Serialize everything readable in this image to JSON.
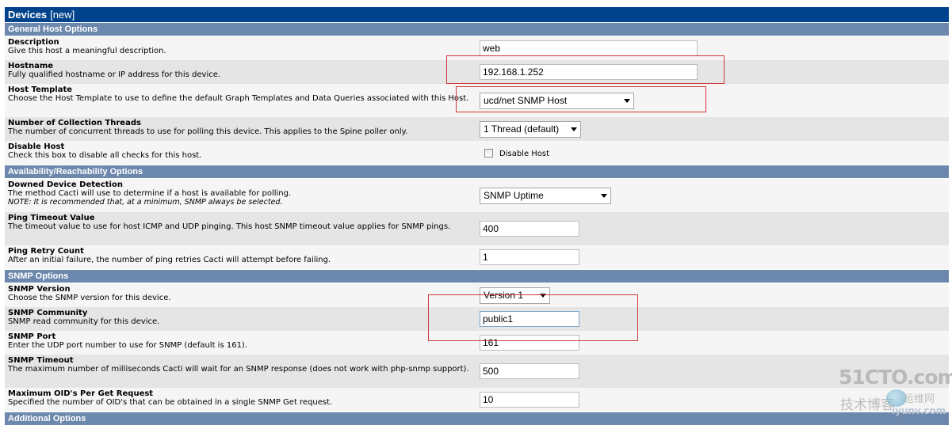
{
  "header": {
    "title": "Devices",
    "subtitle": "[new]"
  },
  "sections": {
    "general": "General Host Options",
    "availability": "Availability/Reachability Options",
    "snmp": "SNMP Options",
    "additional": "Additional Options"
  },
  "fields": {
    "description": {
      "label": "Description",
      "help": "Give this host a meaningful description.",
      "value": "web"
    },
    "hostname": {
      "label": "Hostname",
      "help": "Fully qualified hostname or IP address for this device.",
      "value": "192.168.1.252"
    },
    "host_template": {
      "label": "Host Template",
      "help": "Choose the Host Template to use to define the default Graph Templates and Data Queries associated with this Host.",
      "value": "ucd/net SNMP Host"
    },
    "threads": {
      "label": "Number of Collection Threads",
      "help": "The number of concurrent threads to use for polling this device. This applies to the Spine poller only.",
      "value": "1 Thread (default)"
    },
    "disable_host": {
      "label": "Disable Host",
      "help": "Check this box to disable all checks for this host.",
      "checkbox_label": "Disable Host",
      "checked": false
    },
    "downed_detection": {
      "label": "Downed Device Detection",
      "help": "The method Cacti will use to determine if a host is available for polling.",
      "note": "NOTE: It is recommended that, at a minimum, SNMP always be selected.",
      "value": "SNMP Uptime"
    },
    "ping_timeout": {
      "label": "Ping Timeout Value",
      "help": "The timeout value to use for host ICMP and UDP pinging. This host SNMP timeout value applies for SNMP pings.",
      "value": "400"
    },
    "ping_retry": {
      "label": "Ping Retry Count",
      "help": "After an initial failure, the number of ping retries Cacti will attempt before failing.",
      "value": "1"
    },
    "snmp_version": {
      "label": "SNMP Version",
      "help": "Choose the SNMP version for this device.",
      "value": "Version 1"
    },
    "snmp_community": {
      "label": "SNMP Community",
      "help": "SNMP read community for this device.",
      "value": "public1"
    },
    "snmp_port": {
      "label": "SNMP Port",
      "help": "Enter the UDP port number to use for SNMP (default is 161).",
      "value": "161"
    },
    "snmp_timeout": {
      "label": "SNMP Timeout",
      "help": "The maximum number of milliseconds Cacti will wait for an SNMP response (does not work with php-snmp support).",
      "value": "500"
    },
    "max_oids": {
      "label": "Maximum OID's Per Get Request",
      "help": "Specified the number of OID's that can be obtained in a single SNMP Get request.",
      "value": "10"
    }
  },
  "watermark": {
    "line1": "51CTO.com",
    "line2": "技术博客",
    "line3": "iyunv.com",
    "line4": "运维网"
  },
  "colors": {
    "title_bar": "#00438C",
    "section_bar": "#6d88ad",
    "highlight": "#d03a3a"
  }
}
